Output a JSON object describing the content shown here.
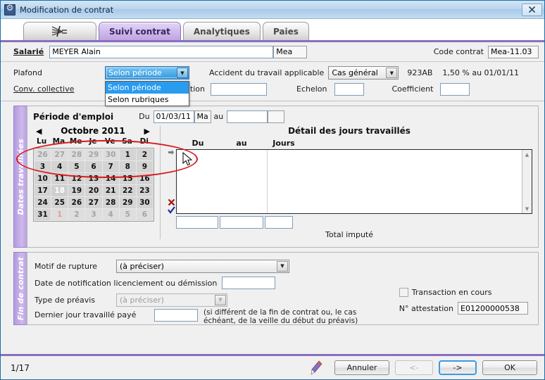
{
  "window": {
    "title": "Modification de contrat",
    "app_icon": "gear-window-icon",
    "close_label": "✖"
  },
  "tabs": [
    {
      "label": "",
      "icon": "fan-icon",
      "active": false
    },
    {
      "label": "Suivi contrat",
      "active": true
    },
    {
      "label": "Analytiques",
      "active": false
    },
    {
      "label": "Paies",
      "active": false
    }
  ],
  "header": {
    "salarie_label": "Salarié",
    "salarie_value": "MEYER Alain",
    "salarie_code": "Mea",
    "code_contrat_label": "Code contrat",
    "code_contrat_value": "Mea-11.03"
  },
  "upper": {
    "plafond_label": "Plafond",
    "plafond_value": "Selon période",
    "plafond_options": [
      "Selon période",
      "Selon rubriques"
    ],
    "plafond_selected_index": 0,
    "conv_collective_label": "Conv. collective",
    "accident_label": "Accident du travail applicable",
    "accident_value": "Cas général",
    "accident_code": "923AB",
    "accident_rate": "1,50 % au 01/01/11",
    "qualification_label": "ication",
    "qualification_value": "",
    "echelon_label": "Echelon",
    "echelon_value": "",
    "coefficient_label": "Coefficient",
    "coefficient_value": ""
  },
  "dates_travaillees": {
    "vtab_label": "Dates travaillées",
    "title": "Période d'emploi",
    "du_label": "Du",
    "du_value": "01/03/11",
    "du_day": "Ma",
    "au_label": "au",
    "au_value": "",
    "au_day": "",
    "calendar": {
      "prev_icon": "chevron-left-icon",
      "next_icon": "chevron-right-icon",
      "month_title": "Octobre 2011",
      "weekdays": [
        "Lu",
        "Ma",
        "Me",
        "Je",
        "Ve",
        "Sa",
        "Di"
      ],
      "today": 18,
      "weeks": [
        [
          {
            "d": "26",
            "out": true
          },
          {
            "d": "27",
            "out": true
          },
          {
            "d": "28",
            "out": true
          },
          {
            "d": "29",
            "out": true
          },
          {
            "d": "30",
            "out": true
          },
          {
            "d": "1"
          },
          {
            "d": "2"
          }
        ],
        [
          {
            "d": "3"
          },
          {
            "d": "4"
          },
          {
            "d": "5"
          },
          {
            "d": "6"
          },
          {
            "d": "7"
          },
          {
            "d": "8"
          },
          {
            "d": "9"
          }
        ],
        [
          {
            "d": "10"
          },
          {
            "d": "11"
          },
          {
            "d": "12"
          },
          {
            "d": "13"
          },
          {
            "d": "14"
          },
          {
            "d": "15"
          },
          {
            "d": "16"
          }
        ],
        [
          {
            "d": "17"
          },
          {
            "d": "18",
            "today": true
          },
          {
            "d": "19"
          },
          {
            "d": "20"
          },
          {
            "d": "21"
          },
          {
            "d": "22"
          },
          {
            "d": "23"
          }
        ],
        [
          {
            "d": "24"
          },
          {
            "d": "25"
          },
          {
            "d": "26"
          },
          {
            "d": "27"
          },
          {
            "d": "28"
          },
          {
            "d": "29"
          },
          {
            "d": "30"
          }
        ],
        [
          {
            "d": "31"
          },
          {
            "d": "1",
            "out": true,
            "hol": true
          },
          {
            "d": "2",
            "out": true
          },
          {
            "d": "3",
            "out": true
          },
          {
            "d": "4",
            "out": true
          },
          {
            "d": "5",
            "out": true
          },
          {
            "d": "6",
            "out": true
          }
        ]
      ]
    },
    "detail": {
      "title": "Détail des jours travaillés",
      "columns": [
        "Du",
        "au",
        "Jours"
      ],
      "rows": [],
      "side_icons": [
        "insert-row-icon",
        "delete-row-icon",
        "validate-row-icon"
      ],
      "total_label": "Total imputé",
      "total_du": "",
      "total_au": "",
      "total_jours": ""
    }
  },
  "fin_de_contrat": {
    "vtab_label": "Fin de contrat",
    "motif_label": "Motif de rupture",
    "motif_value": "(à préciser)",
    "date_notif_label": "Date de notification licenciement ou démission",
    "date_notif_value": "",
    "preavis_label": "Type de préavis",
    "preavis_value": "(à préciser)",
    "dernier_jour_label": "Dernier jour travaillé payé",
    "dernier_jour_value": "",
    "hint_line1": "(si différent de la fin de contrat ou, le cas",
    "hint_line2": "échéant, de la veille du début du préavis)",
    "transaction_label": "Transaction en cours",
    "transaction_checked": false,
    "attestation_label": "N° attestation",
    "attestation_value": "E01200000538"
  },
  "statusbar": {
    "page_count": "1/17",
    "pen_icon": "pen-icon",
    "cancel_label": "Annuler",
    "prev_label": "<-",
    "next_label": "->",
    "ok_label": "OK"
  },
  "colors": {
    "accent_purple": "#8a6fc0",
    "title_blue": "#a9c9e8",
    "highlight_blue": "#2a9cf0",
    "annotation_red": "#d8191b"
  }
}
